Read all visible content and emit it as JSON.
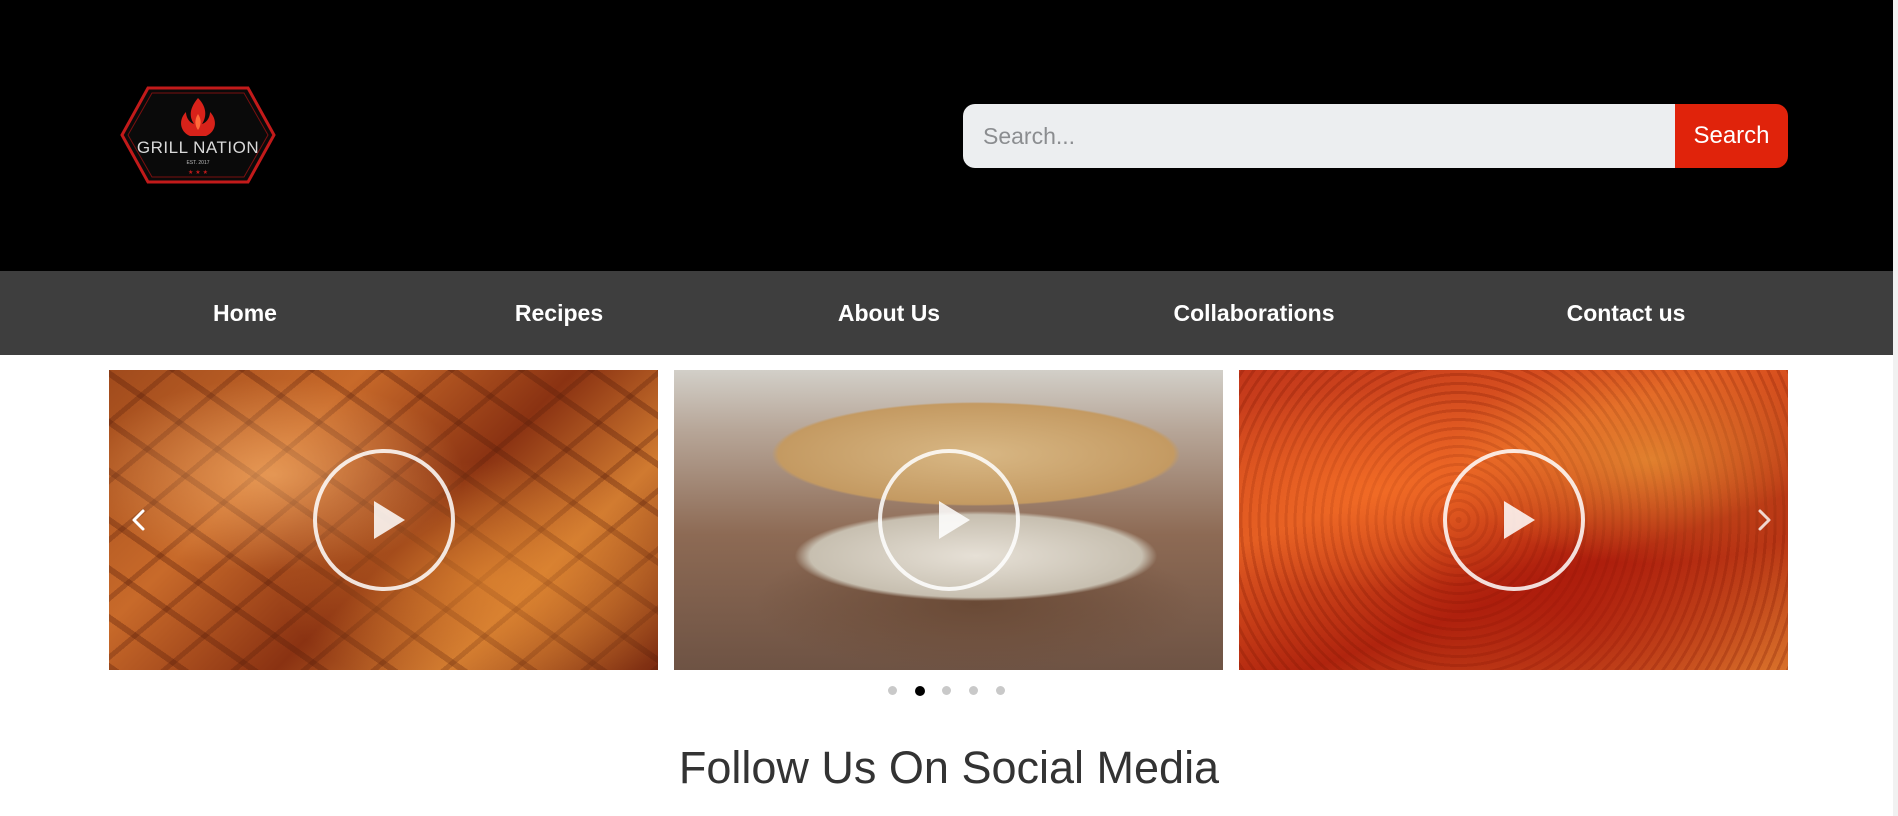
{
  "header": {
    "logo": {
      "brand": "GRILL NATION",
      "tagline": "EST. 2017",
      "icon": "flame-icon"
    },
    "search": {
      "placeholder": "Search...",
      "button_label": "Search"
    }
  },
  "nav": {
    "items": [
      {
        "label": "Home"
      },
      {
        "label": "Recipes"
      },
      {
        "label": "About Us"
      },
      {
        "label": "Collaborations"
      },
      {
        "label": "Contact us"
      }
    ]
  },
  "carousel": {
    "slides": [
      {
        "subject": "smoked-pork-video",
        "icon": "play-icon"
      },
      {
        "subject": "sandwich-video",
        "icon": "play-icon"
      },
      {
        "subject": "seasoned-meat-video",
        "icon": "play-icon"
      }
    ],
    "prev_icon": "chevron-left-icon",
    "next_icon": "chevron-right-icon",
    "dots": {
      "count": 5,
      "active_index": 1
    }
  },
  "social": {
    "title": "Follow Us On Social Media"
  },
  "colors": {
    "header_bg": "#000000",
    "nav_bg": "#3e3e3e",
    "accent": "#e0230b",
    "search_bg": "#eceef0"
  }
}
